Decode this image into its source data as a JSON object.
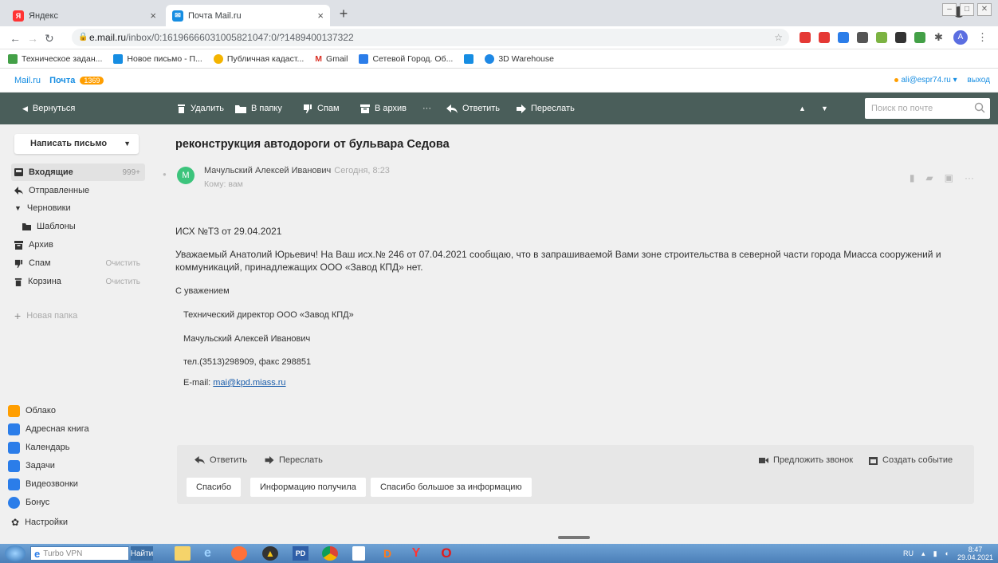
{
  "browser": {
    "tabs": [
      {
        "title": "Яндекс",
        "icon": "yandex-icon",
        "color": "#f33"
      },
      {
        "title": "Почта Mail.ru",
        "icon": "mail-icon",
        "color": "#168de2"
      }
    ],
    "url_host": "e.mail.ru",
    "url_path": "/inbox/0:16196666031005821047:0/?1489400137322",
    "bookmarks": [
      "Техническое задан...",
      "Новое письмо - П...",
      "Публичная кадаст...",
      "Gmail",
      "Сетевой Город. Об...",
      "3D Warehouse"
    ],
    "profile_initial": "A"
  },
  "mail": {
    "brand": "Mail.ru",
    "section": "Почта",
    "unread_badge": "1369",
    "account": "ali@espr74.ru",
    "logout": "выход"
  },
  "toolbar": {
    "back": "Вернуться",
    "delete": "Удалить",
    "to_folder": "В папку",
    "spam": "Спам",
    "archive": "В архив",
    "more": "···",
    "reply": "Ответить",
    "forward": "Переслать",
    "search_placeholder": "Поиск по почте"
  },
  "sidebar": {
    "compose": "Написать письмо",
    "folders": [
      {
        "label": "Входящие",
        "count": "999+",
        "icon": "inbox-icon"
      },
      {
        "label": "Отправленные",
        "icon": "sent-icon"
      },
      {
        "label": "Черновики",
        "icon": "drafts-icon"
      },
      {
        "label": "Шаблоны",
        "icon": "templates-icon"
      },
      {
        "label": "Архив",
        "icon": "archive-icon"
      },
      {
        "label": "Спам",
        "action": "Очистить",
        "icon": "spam-icon"
      },
      {
        "label": "Корзина",
        "action": "Очистить",
        "icon": "trash-icon"
      }
    ],
    "new_folder": "Новая папка",
    "apps": [
      {
        "label": "Облако",
        "color": "#ff9e00"
      },
      {
        "label": "Адресная книга",
        "color": "#2b7de9"
      },
      {
        "label": "Календарь",
        "color": "#2b7de9"
      },
      {
        "label": "Задачи",
        "color": "#2b7de9"
      },
      {
        "label": "Видеозвонки",
        "color": "#2b7de9"
      },
      {
        "label": "Бонус",
        "color": "#2b7de9"
      },
      {
        "label": "Настройки",
        "color": "#333333"
      }
    ]
  },
  "message": {
    "subject": "реконструкция автодороги от бульвара Седова",
    "avatar_letter": "М",
    "sender": "Мачульский Алексей Иванович",
    "time": "Сегодня, 8:23",
    "recipient": "Кому: вам",
    "body": {
      "ref": "ИСХ №Т3 от 29.04.2021",
      "para_line1": "Уважаемый Анатолий Юрьевич! На Ваш исх.№ 246 от 07.04.2021 сообщаю, что в запрашиваемой Вами зоне строительства в северной части города Миасса сооружений и",
      "para_line2": "коммуникаций, принадлежащих ООО «Завод КПД» нет.",
      "regards": "С уважением",
      "position": "Технический директор ООО «Завод КПД»",
      "name": "Мачульский Алексей Иванович",
      "phone": "тел.(3513)298909, факс 298851",
      "email_label": "E-mail:",
      "email": "mai@kpd.miass.ru"
    }
  },
  "reply_panel": {
    "reply": "Ответить",
    "forward": "Переслать",
    "call": "Предложить звонок",
    "event": "Создать событие",
    "quick_replies": [
      "Спасибо",
      "Информацию получила",
      "Спасибо большое за информацию"
    ]
  },
  "taskbar": {
    "vpn": "Turbo VPN",
    "find": "Найти",
    "lang": "RU",
    "time": "8:47",
    "date": "29.04.2021"
  }
}
